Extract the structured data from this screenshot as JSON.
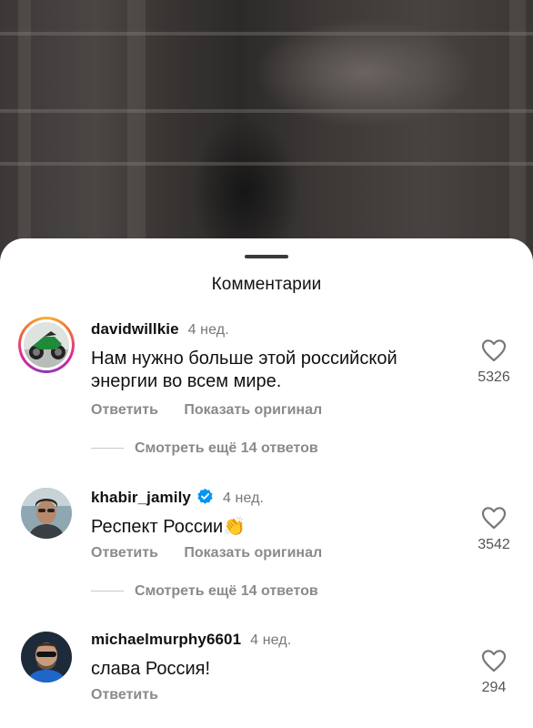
{
  "sheet": {
    "title": "Комментарии"
  },
  "comments": [
    {
      "username": "davidwillkie",
      "time": "4 нед.",
      "verified": false,
      "text_lines": [
        "Нам нужно больше этой российской",
        "энергии во всем мире."
      ],
      "reply_label": "Ответить",
      "translate_label": "Показать оригинал",
      "likes": "5326",
      "more_replies": "Смотреть ещё 14 ответов"
    },
    {
      "username": "khabir_jamily",
      "time": "4 нед.",
      "verified": true,
      "text": "Респект России👏",
      "reply_label": "Ответить",
      "translate_label": "Показать оригинал",
      "likes": "3542",
      "more_replies": "Смотреть ещё 14 ответов"
    },
    {
      "username": "michaelmurphy6601",
      "time": "4 нед.",
      "verified": false,
      "text": "слава Россия!",
      "reply_label": "Ответить",
      "likes": "294"
    }
  ],
  "colors": {
    "verified_blue": "#0095f6",
    "secondary_text": "#8a8a8a"
  },
  "icons": [
    "heart-icon",
    "verified-badge-icon"
  ]
}
